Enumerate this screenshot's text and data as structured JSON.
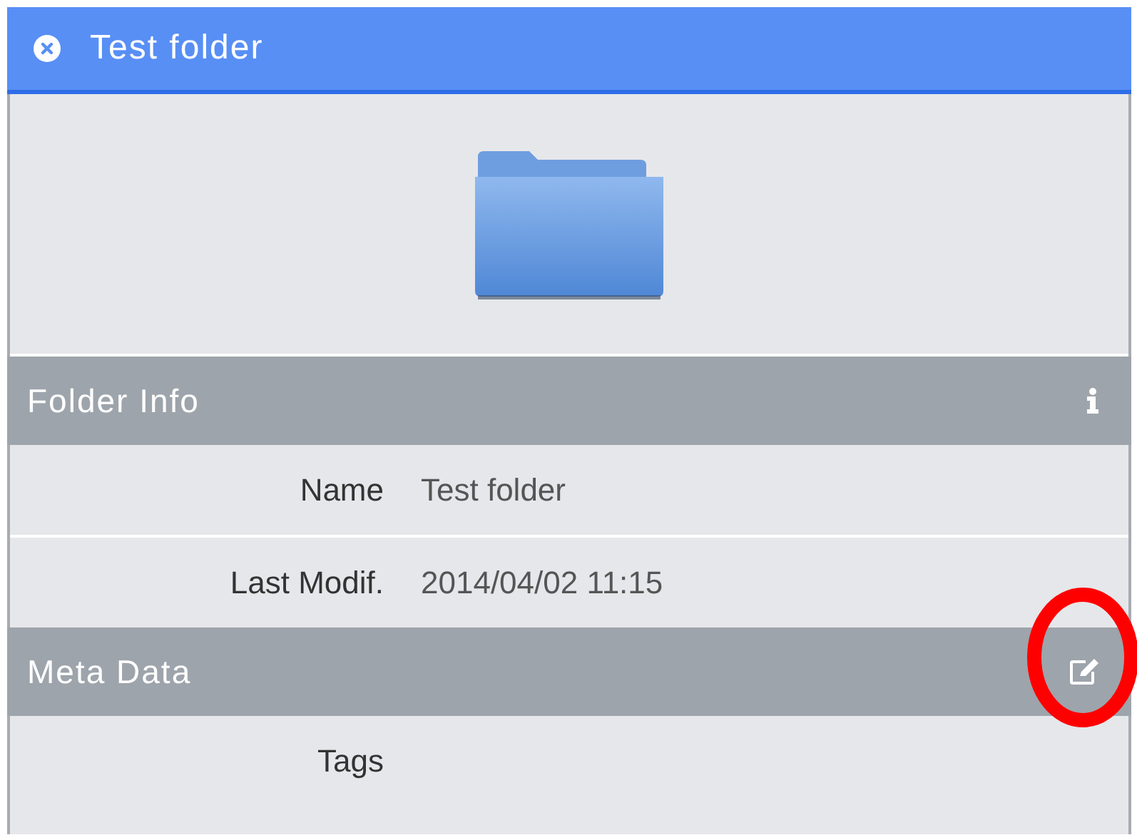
{
  "window": {
    "title": "Test folder"
  },
  "sections": [
    {
      "title": "Folder Info",
      "kind": "info",
      "highlighted": false,
      "rows": [
        {
          "label": "Name",
          "value": "Test folder"
        },
        {
          "label": "Last Modif.",
          "value": "2014/04/02 11:15"
        }
      ]
    },
    {
      "title": "Meta Data",
      "kind": "edit",
      "highlighted": true,
      "rows": [
        {
          "label": "Tags"
        }
      ]
    }
  ]
}
